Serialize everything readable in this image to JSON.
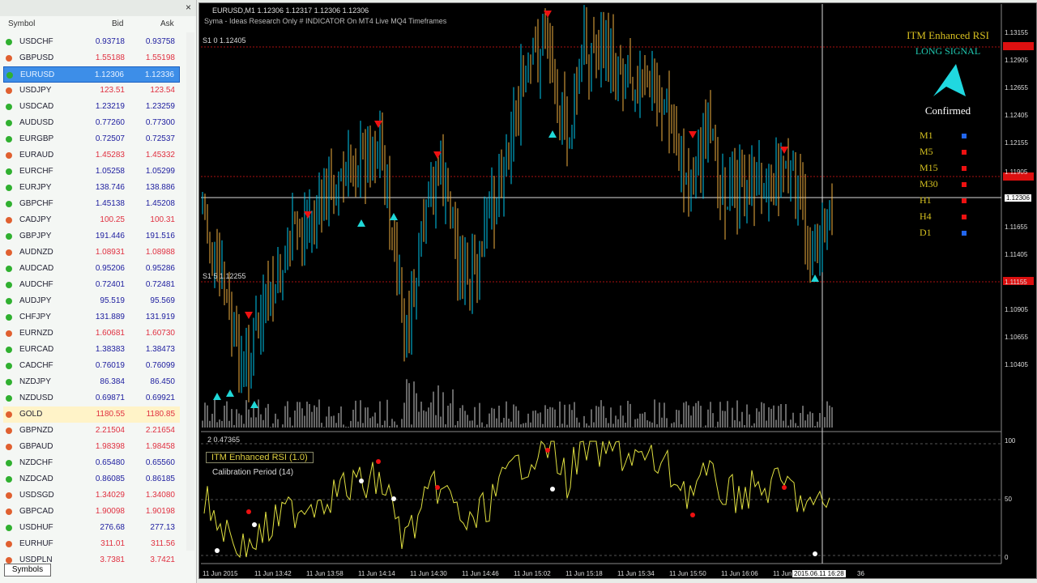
{
  "market_watch": {
    "columns": {
      "symbol": "Symbol",
      "bid": "Bid",
      "ask": "Ask"
    },
    "tab": "Symbols",
    "rows": [
      {
        "symbol": "USDCHF",
        "bid": "0.93718",
        "ask": "0.93758",
        "dir": "up"
      },
      {
        "symbol": "GBPUSD",
        "bid": "1.55188",
        "ask": "1.55198",
        "dir": "dn"
      },
      {
        "symbol": "EURUSD",
        "bid": "1.12306",
        "ask": "1.12336",
        "dir": "up",
        "selected": true
      },
      {
        "symbol": "USDJPY",
        "bid": "123.51",
        "ask": "123.54",
        "dir": "dn"
      },
      {
        "symbol": "USDCAD",
        "bid": "1.23219",
        "ask": "1.23259",
        "dir": "up"
      },
      {
        "symbol": "AUDUSD",
        "bid": "0.77260",
        "ask": "0.77300",
        "dir": "up"
      },
      {
        "symbol": "EURGBP",
        "bid": "0.72507",
        "ask": "0.72537",
        "dir": "up"
      },
      {
        "symbol": "EURAUD",
        "bid": "1.45283",
        "ask": "1.45332",
        "dir": "dn"
      },
      {
        "symbol": "EURCHF",
        "bid": "1.05258",
        "ask": "1.05299",
        "dir": "up"
      },
      {
        "symbol": "EURJPY",
        "bid": "138.746",
        "ask": "138.886",
        "dir": "up"
      },
      {
        "symbol": "GBPCHF",
        "bid": "1.45138",
        "ask": "1.45208",
        "dir": "up"
      },
      {
        "symbol": "CADJPY",
        "bid": "100.25",
        "ask": "100.31",
        "dir": "dn"
      },
      {
        "symbol": "GBPJPY",
        "bid": "191.446",
        "ask": "191.516",
        "dir": "up"
      },
      {
        "symbol": "AUDNZD",
        "bid": "1.08931",
        "ask": "1.08988",
        "dir": "dn"
      },
      {
        "symbol": "AUDCAD",
        "bid": "0.95206",
        "ask": "0.95286",
        "dir": "up"
      },
      {
        "symbol": "AUDCHF",
        "bid": "0.72401",
        "ask": "0.72481",
        "dir": "up"
      },
      {
        "symbol": "AUDJPY",
        "bid": "95.519",
        "ask": "95.569",
        "dir": "up"
      },
      {
        "symbol": "CHFJPY",
        "bid": "131.889",
        "ask": "131.919",
        "dir": "up"
      },
      {
        "symbol": "EURNZD",
        "bid": "1.60681",
        "ask": "1.60730",
        "dir": "dn"
      },
      {
        "symbol": "EURCAD",
        "bid": "1.38383",
        "ask": "1.38473",
        "dir": "up"
      },
      {
        "symbol": "CADCHF",
        "bid": "0.76019",
        "ask": "0.76099",
        "dir": "up"
      },
      {
        "symbol": "NZDJPY",
        "bid": "86.384",
        "ask": "86.450",
        "dir": "up"
      },
      {
        "symbol": "NZDUSD",
        "bid": "0.69871",
        "ask": "0.69921",
        "dir": "up"
      },
      {
        "symbol": "GOLD",
        "bid": "1180.55",
        "ask": "1180.85",
        "dir": "dn",
        "highlight": true
      },
      {
        "symbol": "GBPNZD",
        "bid": "2.21504",
        "ask": "2.21654",
        "dir": "dn"
      },
      {
        "symbol": "GBPAUD",
        "bid": "1.98398",
        "ask": "1.98458",
        "dir": "dn"
      },
      {
        "symbol": "NZDCHF",
        "bid": "0.65480",
        "ask": "0.65560",
        "dir": "up"
      },
      {
        "symbol": "NZDCAD",
        "bid": "0.86085",
        "ask": "0.86185",
        "dir": "up"
      },
      {
        "symbol": "USDSGD",
        "bid": "1.34029",
        "ask": "1.34080",
        "dir": "dn"
      },
      {
        "symbol": "GBPCAD",
        "bid": "1.90098",
        "ask": "1.90198",
        "dir": "dn"
      },
      {
        "symbol": "USDHUF",
        "bid": "276.68",
        "ask": "277.13",
        "dir": "up"
      },
      {
        "symbol": "EURHUF",
        "bid": "311.01",
        "ask": "311.56",
        "dir": "dn"
      },
      {
        "symbol": "USDPLN",
        "bid": "3.7381",
        "ask": "3.7421",
        "dir": "dn"
      }
    ]
  },
  "chart": {
    "title": "EURUSD,M1  1.12306 1.12317 1.12306 1.12306",
    "subtitle": "Syma - Ideas Research Only # INDICATOR On MT4 Live MQ4 Timeframes",
    "level_top": "S1 0 1.12405",
    "level_mid": "S1 5 1.12255",
    "panel_title": "ITM Enhanced RSI",
    "panel_signal": "LONG SIGNAL",
    "panel_status": "Confirmed",
    "timeframes": [
      {
        "label": "M1",
        "color": "#2266ee"
      },
      {
        "label": "M5",
        "color": "#ee1111"
      },
      {
        "label": "M15",
        "color": "#ee1111"
      },
      {
        "label": "M30",
        "color": "#ee1111"
      },
      {
        "label": "H1",
        "color": "#ee1111"
      },
      {
        "label": "H4",
        "color": "#ee1111"
      },
      {
        "label": "D1",
        "color": "#2266ee"
      }
    ],
    "price_labels": [
      "1.13155",
      "1.12905",
      "1.12655",
      "1.12405",
      "1.12155",
      "1.12306",
      "1.11905",
      "1.11655",
      "1.11405",
      "1.11155",
      "1.10905",
      "1.10655",
      "1.10405"
    ],
    "current_price": "1.12306",
    "indicator_header": "2 0.47365",
    "indicator_name": "ITM Enhanced RSI (1.0)",
    "indicator_param": "Calibration Period (14)",
    "indicator_levels": [
      "100",
      "50",
      "0"
    ],
    "time_labels": [
      "11 Jun 2015",
      "11 Jun 13:42",
      "11 Jun 13:58",
      "11 Jun 14:14",
      "11 Jun 14:30",
      "11 Jun 14:46",
      "11 Jun 15:02",
      "11 Jun 15:18",
      "11 Jun 15:34",
      "11 Jun 15:50",
      "11 Jun 16:06",
      "11 Jun 16:22"
    ],
    "crosshair_time": "2015.06.11 16:28",
    "crosshair_extra": "36",
    "crosshair_value": "1.12306",
    "colors": {
      "up": "#00c8ee",
      "down": "#f0b040",
      "arrow_up": "#20d8d8",
      "arrow_down": "#ee1111",
      "rsi": "#e0e040"
    }
  }
}
